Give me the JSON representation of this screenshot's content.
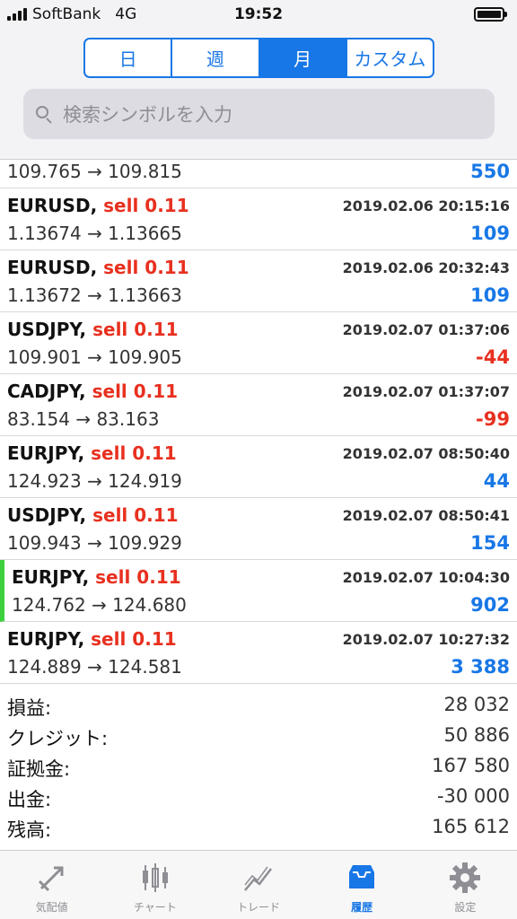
{
  "status_bar": {
    "carrier": "SoftBank",
    "network": "4G",
    "time": "19:52"
  },
  "period_tabs": [
    {
      "label": "日",
      "active": false
    },
    {
      "label": "週",
      "active": false
    },
    {
      "label": "月",
      "active": true
    },
    {
      "label": "カスタム",
      "active": false
    }
  ],
  "search": {
    "placeholder": "検索シンボルを入力"
  },
  "partial_row": {
    "prices": "109.765 → 109.815",
    "profit": "550"
  },
  "deals": [
    {
      "symbol": "EURUSD",
      "sep": ",",
      "side": "sell 0.11",
      "datetime": "2019.02.06 20:15:16",
      "prices": "1.13674 → 1.13665",
      "profit": "109"
    },
    {
      "symbol": "EURUSD",
      "sep": ",",
      "side": "sell 0.11",
      "datetime": "2019.02.06 20:32:43",
      "prices": "1.13672 → 1.13663",
      "profit": "109"
    },
    {
      "symbol": "USDJPY",
      "sep": ",",
      "side": "sell 0.11",
      "datetime": "2019.02.07 01:37:06",
      "prices": "109.901 → 109.905",
      "profit": "-44"
    },
    {
      "symbol": "CADJPY",
      "sep": ",",
      "side": "sell 0.11",
      "datetime": "2019.02.07 01:37:07",
      "prices": "83.154 → 83.163",
      "profit": "-99"
    },
    {
      "symbol": "EURJPY",
      "sep": ",",
      "side": "sell 0.11",
      "datetime": "2019.02.07 08:50:40",
      "prices": "124.923 → 124.919",
      "profit": "44"
    },
    {
      "symbol": "USDJPY",
      "sep": ",",
      "side": "sell 0.11",
      "datetime": "2019.02.07 08:50:41",
      "prices": "109.943 → 109.929",
      "profit": "154"
    },
    {
      "symbol": "EURJPY",
      "sep": ",",
      "side": "sell 0.11",
      "datetime": "2019.02.07 10:04:30",
      "prices": "124.762 → 124.680",
      "profit": "902"
    },
    {
      "symbol": "EURJPY",
      "sep": ",",
      "side": "sell 0.11",
      "datetime": "2019.02.07 10:27:32",
      "prices": "124.889 → 124.581",
      "profit": "3 388"
    }
  ],
  "summary": [
    {
      "label": "損益:",
      "value": "28 032"
    },
    {
      "label": "クレジット:",
      "value": "50 886"
    },
    {
      "label": "証拠金:",
      "value": "167 580"
    },
    {
      "label": "出金:",
      "value": "-30 000"
    },
    {
      "label": "残高:",
      "value": "165 612"
    }
  ],
  "tabbar": [
    {
      "label": "気配値",
      "icon": "quotes-icon",
      "active": false
    },
    {
      "label": "チャート",
      "icon": "chart-icon",
      "active": false
    },
    {
      "label": "トレード",
      "icon": "trade-icon",
      "active": false
    },
    {
      "label": "履歴",
      "icon": "history-icon",
      "active": true
    },
    {
      "label": "設定",
      "icon": "gear-icon",
      "active": false
    }
  ],
  "colors": {
    "accent": "#1877e6",
    "negative": "#e8301f",
    "highlight": "#3cd13c"
  }
}
